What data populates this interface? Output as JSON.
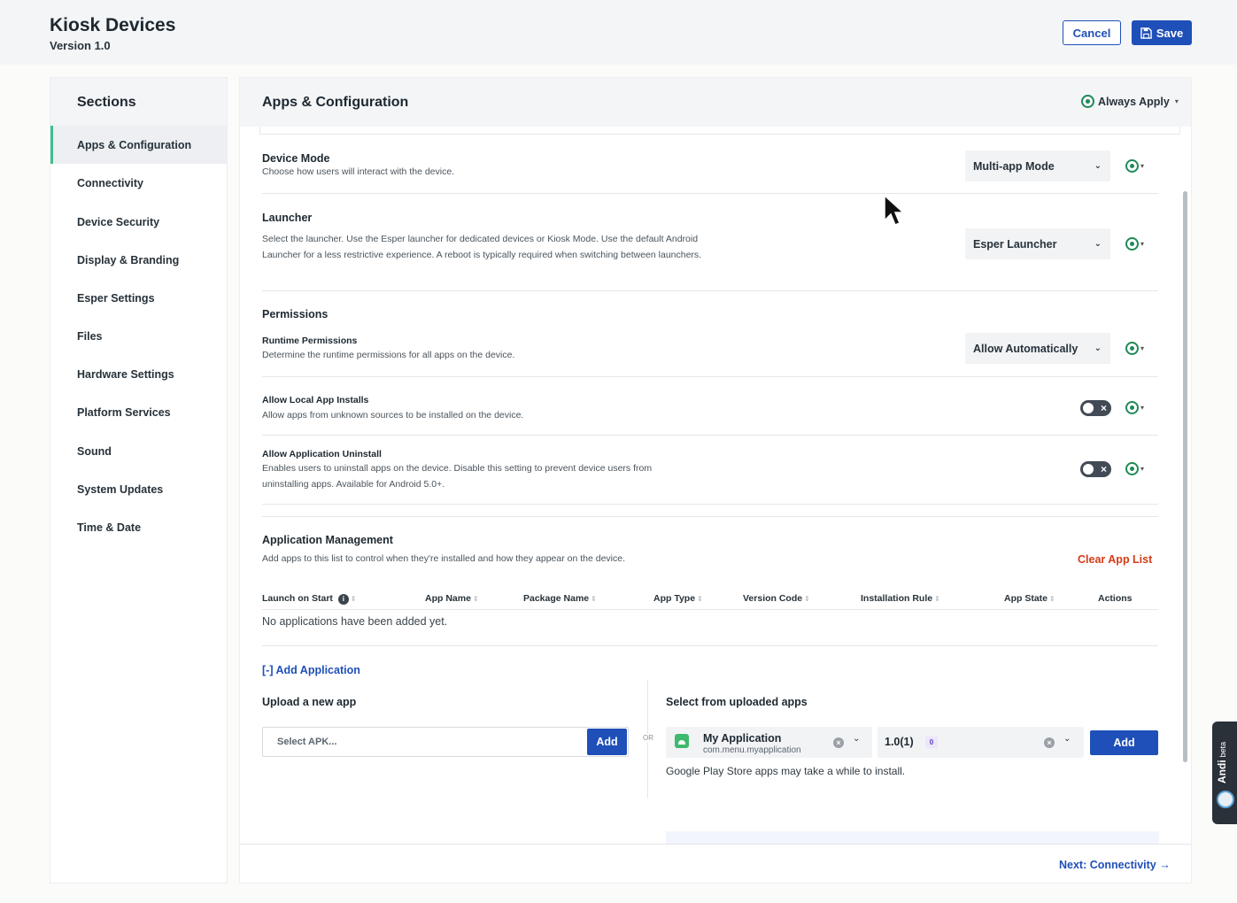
{
  "header": {
    "title": "Kiosk Devices",
    "version": "Version 1.0",
    "cancel_label": "Cancel",
    "save_label": "Save"
  },
  "sidebar": {
    "title": "Sections",
    "items": [
      {
        "label": "Apps & Configuration",
        "active": true
      },
      {
        "label": "Connectivity"
      },
      {
        "label": "Device Security"
      },
      {
        "label": "Display & Branding"
      },
      {
        "label": "Esper Settings"
      },
      {
        "label": "Files"
      },
      {
        "label": "Hardware Settings"
      },
      {
        "label": "Platform Services"
      },
      {
        "label": "Sound"
      },
      {
        "label": "System Updates"
      },
      {
        "label": "Time & Date"
      }
    ]
  },
  "main": {
    "title": "Apps & Configuration",
    "always_apply_label": "Always Apply",
    "device_mode": {
      "label": "Device Mode",
      "desc": "Choose how users will interact with the device.",
      "value": "Multi-app Mode"
    },
    "launcher": {
      "label": "Launcher",
      "desc": "Select the launcher. Use the Esper launcher for dedicated devices or Kiosk Mode. Use the default Android Launcher for a less restrictive experience. A reboot is typically required when switching between launchers.",
      "value": "Esper Launcher"
    },
    "permissions": {
      "heading": "Permissions",
      "runtime_label": "Runtime Permissions",
      "runtime_desc": "Determine the runtime permissions for all apps on the device.",
      "runtime_value": "Allow Automatically",
      "local_installs_label": "Allow Local App Installs",
      "local_installs_desc": "Allow apps from unknown sources to be installed on the device.",
      "uninstall_label": "Allow Application Uninstall",
      "uninstall_desc": "Enables users to uninstall apps on the device. Disable this setting to prevent device users from uninstalling apps. Available for Android 5.0+."
    },
    "app_management": {
      "heading": "Application Management",
      "desc": "Add apps to this list to control when they're installed and how they appear on the device.",
      "clear_label": "Clear App List",
      "columns": [
        "Launch on Start",
        "App Name",
        "Package Name",
        "App Type",
        "Version Code",
        "Installation Rule",
        "App State",
        "Actions"
      ],
      "empty_message": "No applications have been added yet.",
      "add_link": "[-] Add Application",
      "upload_heading": "Upload a new app",
      "apk_placeholder": "Select APK...",
      "add_label": "Add",
      "or_label": "OR",
      "select_heading": "Select from uploaded apps",
      "selected_app_name": "My Application",
      "selected_app_package": "com.menu.myapplication",
      "selected_version": "1.0(1)",
      "version_badge": "0",
      "play_note": "Google Play Store apps may take a while to install."
    },
    "next_label": "Next: Connectivity →"
  },
  "andi": {
    "label": "Andi",
    "beta": "beta"
  },
  "colors": {
    "primary": "#1f4fb8",
    "active_indicator": "#3fbd8e",
    "apply_ring": "#1f8a59",
    "danger": "#d43b16"
  }
}
